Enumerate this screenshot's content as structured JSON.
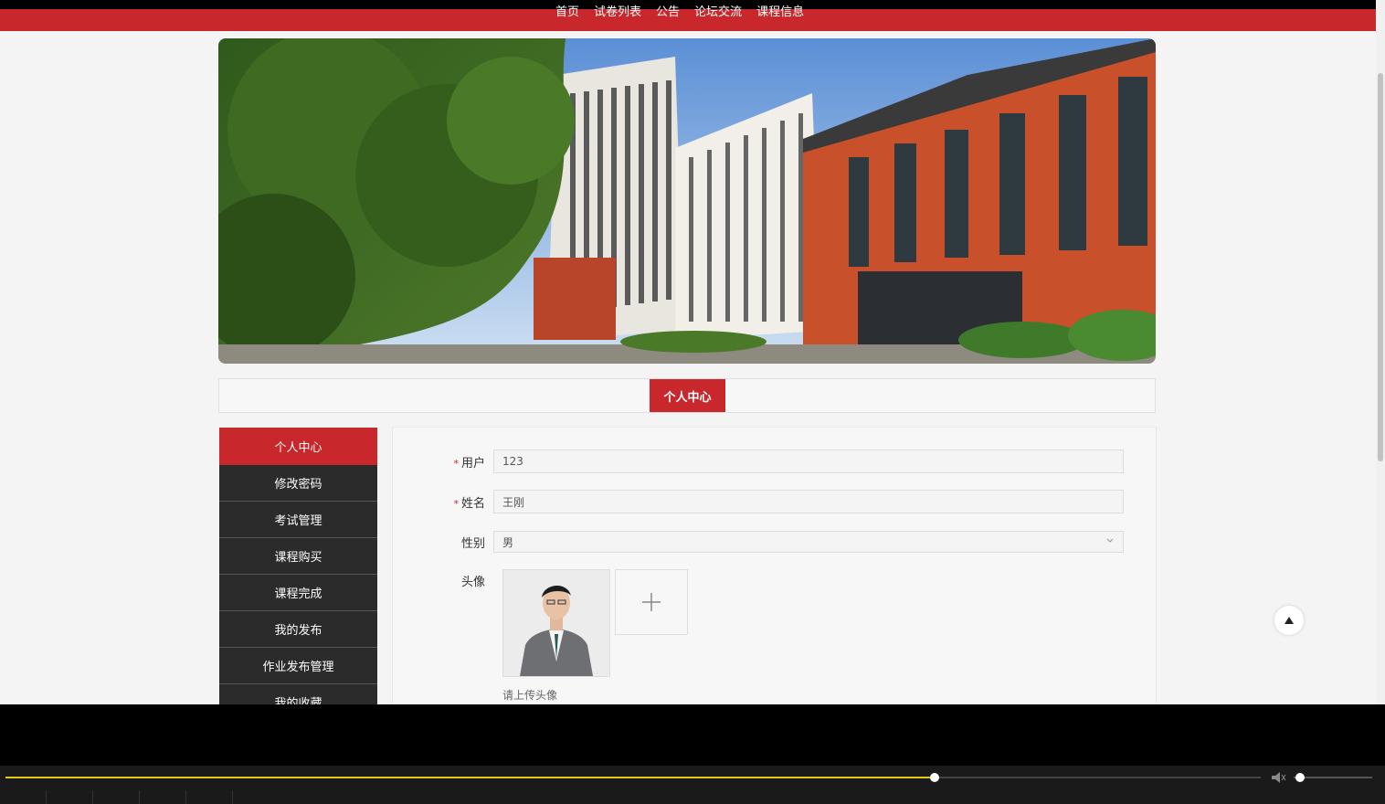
{
  "nav": {
    "items": [
      "首页",
      "试卷列表",
      "公告",
      "论坛交流",
      "课程信息"
    ]
  },
  "tab": {
    "label": "个人中心"
  },
  "sidebar": {
    "items": [
      "个人中心",
      "修改密码",
      "考试管理",
      "课程购买",
      "课程完成",
      "我的发布",
      "作业发布管理",
      "我的收藏"
    ]
  },
  "form": {
    "username": {
      "label": "用户",
      "value": "123"
    },
    "name": {
      "label": "姓名",
      "value": "王刚"
    },
    "gender": {
      "label": "性别",
      "value": "男"
    },
    "avatar": {
      "label": "头像",
      "hint": "请上传头像"
    }
  },
  "player": {
    "progress": 0.74,
    "volume": 0.08
  },
  "colors": {
    "accent": "#c8282c",
    "sidebar": "#2b2b2b",
    "progress": "#e6c619"
  }
}
